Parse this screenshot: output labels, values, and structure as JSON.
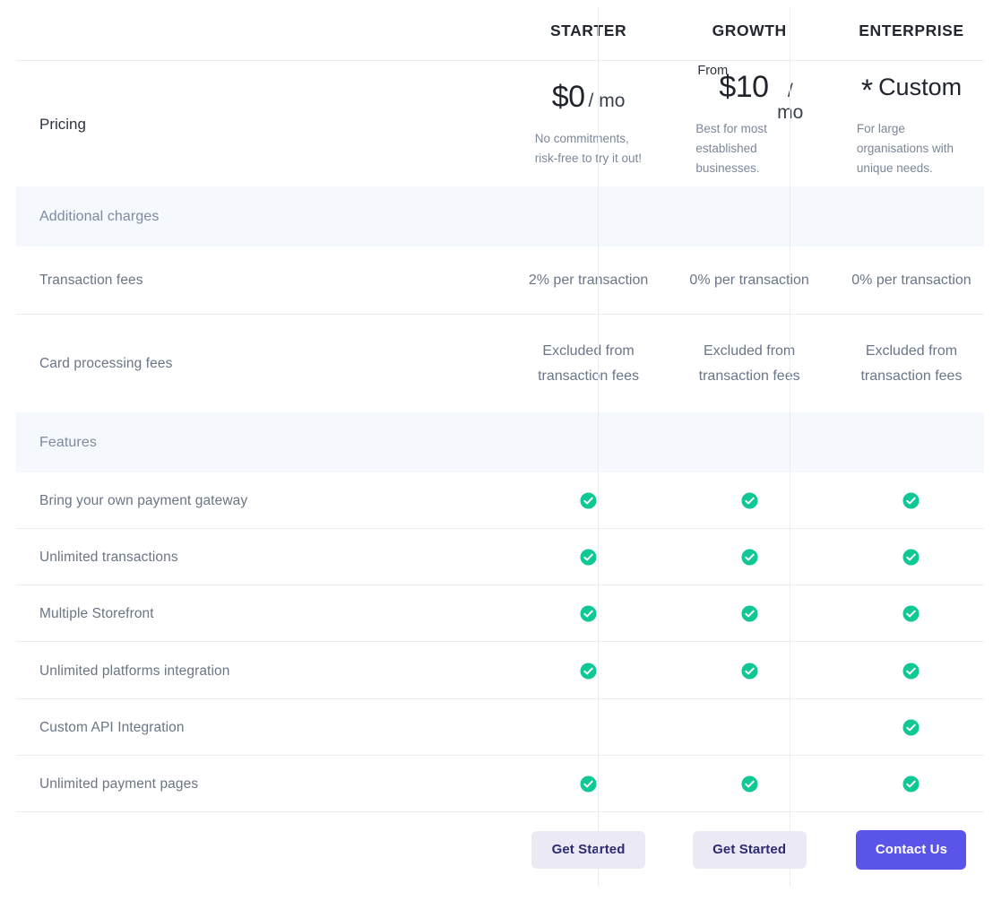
{
  "columns": [
    {
      "id": "starter",
      "name": "STARTER"
    },
    {
      "id": "growth",
      "name": "GROWTH"
    },
    {
      "id": "enterprise",
      "name": "ENTERPRISE"
    }
  ],
  "pricing": {
    "row_label": "Pricing",
    "starter": {
      "from_label": "",
      "amount": "$0",
      "per": "/ mo",
      "star": "",
      "custom": "",
      "description": "No commitments, risk-free to try it out!"
    },
    "growth": {
      "from_label": "From",
      "amount": "$10",
      "per": "/ mo",
      "star": "",
      "custom": "",
      "description": "Best for most established businesses."
    },
    "enterprise": {
      "from_label": "",
      "amount": "",
      "per": "",
      "star": "*",
      "custom": "Custom",
      "description": "For large organisations with unique needs."
    }
  },
  "sections": {
    "additional_charges": "Additional charges",
    "features": "Features"
  },
  "charges_rows": [
    {
      "label": "Transaction fees",
      "starter": "2% per transaction",
      "growth": "0% per transaction",
      "enterprise": "0% per transaction"
    },
    {
      "label": "Card processing fees",
      "starter": "Excluded from transaction fees",
      "growth": "Excluded from transaction fees",
      "enterprise": "Excluded from transaction fees"
    }
  ],
  "feature_rows": [
    {
      "label": "Bring your own payment gateway",
      "starter": true,
      "growth": true,
      "enterprise": true
    },
    {
      "label": "Unlimited transactions",
      "starter": true,
      "growth": true,
      "enterprise": true
    },
    {
      "label": "Multiple Storefront",
      "starter": true,
      "growth": true,
      "enterprise": true
    },
    {
      "label": "Unlimited platforms integration",
      "starter": true,
      "growth": true,
      "enterprise": true
    },
    {
      "label": "Custom API Integration",
      "starter": false,
      "growth": false,
      "enterprise": true
    },
    {
      "label": "Unlimited payment pages",
      "starter": true,
      "growth": true,
      "enterprise": true
    }
  ],
  "cta": {
    "starter": "Get Started",
    "growth": "Get Started",
    "enterprise": "Contact Us"
  },
  "icons": {
    "check": "check-circle-icon"
  },
  "colors": {
    "check_green": "#0FC896",
    "primary_purple": "#5B54E8",
    "secondary_button_bg": "#EBE9F4",
    "secondary_button_text": "#2D2A72",
    "band_bg": "#F5F8FD",
    "divider": "#E9EDF4",
    "label_text": "#6A7585",
    "value_text": "#69768A",
    "heading_text": "#23272F"
  }
}
